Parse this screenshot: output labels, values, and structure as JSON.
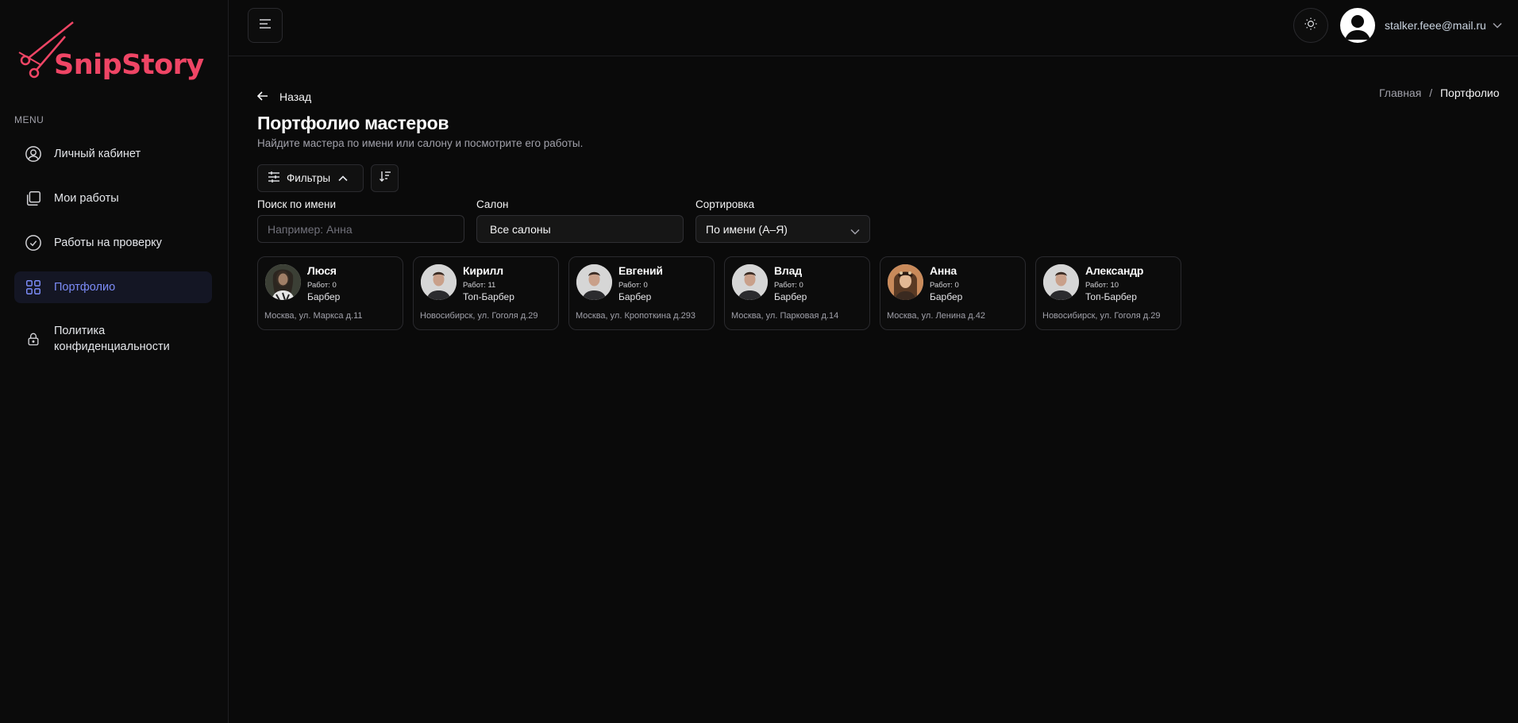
{
  "brand": {
    "name": "SnipStory",
    "color": "#ef4565"
  },
  "sidebar": {
    "menu_caption": "MENU",
    "items": [
      {
        "label": "Личный кабинет",
        "icon": "user-circle-icon",
        "active": false
      },
      {
        "label": "Мои работы",
        "icon": "copy-icon",
        "active": false
      },
      {
        "label": "Работы на проверку",
        "icon": "check-circle-icon",
        "active": false
      },
      {
        "label": "Портфолио",
        "icon": "grid-icon",
        "active": true
      },
      {
        "label": "Политика конфиденциальности",
        "icon": "lock-icon",
        "active": false
      }
    ]
  },
  "header": {
    "user_email": "stalker.feee@mail.ru"
  },
  "page": {
    "back_label": "Назад",
    "breadcrumb": {
      "home": "Главная",
      "separator": "/",
      "current": "Портфолио"
    },
    "title": "Портфолио мастеров",
    "subtitle": "Найдите мастера по имени или салону и посмотрите его работы.",
    "filters_label": "Фильтры",
    "search": {
      "label": "Поиск по имени",
      "placeholder": "Например: Анна",
      "value": ""
    },
    "salon": {
      "label": "Салон",
      "value": "Все салоны"
    },
    "sort": {
      "label": "Сортировка",
      "value": "По имени (А–Я)"
    }
  },
  "masters": [
    {
      "name": "Люся",
      "works": "Работ: 0",
      "role": "Барбер",
      "address": "Москва, ул. Маркса д.11",
      "avatar": "photo-woman-dark"
    },
    {
      "name": "Кирилл",
      "works": "Работ: 11",
      "role": "Топ-Барбер",
      "address": "Новосибирск, ул. Гоголя д.29",
      "avatar": "photo-man"
    },
    {
      "name": "Евгений",
      "works": "Работ: 0",
      "role": "Барбер",
      "address": "Москва, ул. Кропоткина д.293",
      "avatar": "photo-man"
    },
    {
      "name": "Влад",
      "works": "Работ: 0",
      "role": "Барбер",
      "address": "Москва, ул. Парковая д.14",
      "avatar": "photo-man"
    },
    {
      "name": "Анна",
      "works": "Работ: 0",
      "role": "Барбер",
      "address": "Москва, ул. Ленина д.42",
      "avatar": "photo-woman-warm"
    },
    {
      "name": "Александр",
      "works": "Работ: 10",
      "role": "Топ-Барбер",
      "address": "Новосибирск, ул. Гоголя д.29",
      "avatar": "photo-man"
    }
  ]
}
